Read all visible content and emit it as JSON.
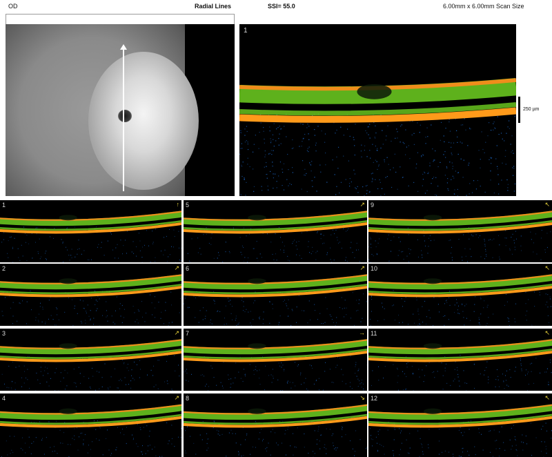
{
  "header": {
    "eye": "OD",
    "protocol": "Radial Lines",
    "ssi": "SSI= 55.0",
    "scan_size": "6.00mm x 6.00mm Scan Size"
  },
  "main_scan": {
    "number": "1"
  },
  "scale_bar": {
    "label": "250 µm"
  },
  "colors": {
    "ilm_band": "#ff8a1c",
    "rpe_band": "#ff9a1a",
    "tissue": "#6fd021",
    "noise": "#1e6fd6"
  },
  "icons": {
    "scan_direction": "arrow-icon"
  },
  "thumbnails": [
    {
      "number": "1",
      "arrow": "↑"
    },
    {
      "number": "5",
      "arrow": "↗"
    },
    {
      "number": "9",
      "arrow": "↖"
    },
    {
      "number": "2",
      "arrow": "↗"
    },
    {
      "number": "6",
      "arrow": "↗"
    },
    {
      "number": "10",
      "arrow": "↖"
    },
    {
      "number": "3",
      "arrow": "↗"
    },
    {
      "number": "7",
      "arrow": "→"
    },
    {
      "number": "11",
      "arrow": "↖"
    },
    {
      "number": "4",
      "arrow": "↗"
    },
    {
      "number": "8",
      "arrow": "↘"
    },
    {
      "number": "12",
      "arrow": "↖"
    }
  ]
}
